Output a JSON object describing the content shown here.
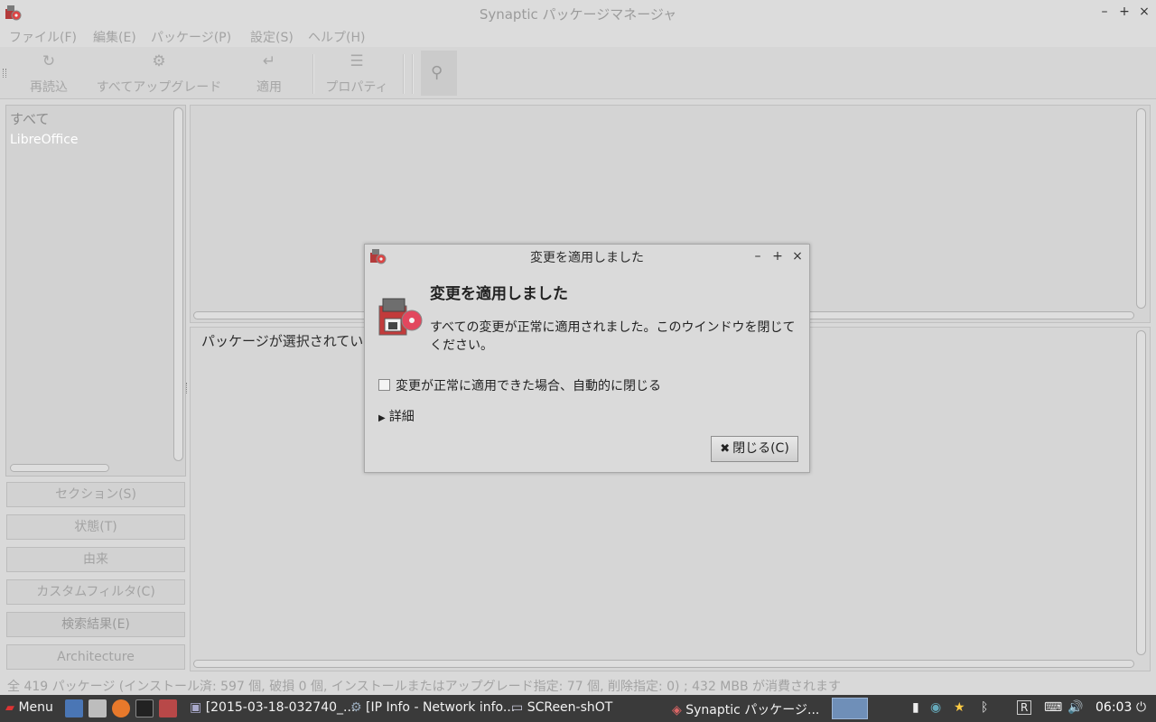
{
  "window": {
    "title": "Synaptic パッケージマネージャ",
    "controls": {
      "minimize": "–",
      "maximize": "+",
      "close": "×"
    }
  },
  "menubar": {
    "items": [
      "ファイル(F)",
      "編集(E)",
      "パッケージ(P)",
      "設定(S)",
      "ヘルプ(H)"
    ]
  },
  "toolbar": {
    "reload": {
      "label": "再読込",
      "icon": "reload-icon",
      "glyph": "↻"
    },
    "upgrade_all": {
      "label": "すべてアップグレード",
      "icon": "gear-icon",
      "glyph": "⚙"
    },
    "apply": {
      "label": "適用",
      "icon": "apply-icon",
      "glyph": "↵"
    },
    "properties": {
      "label": "プロパティ",
      "icon": "properties-icon",
      "glyph": "☰"
    },
    "search": {
      "icon": "search-icon",
      "glyph": "⚲"
    }
  },
  "sidebar": {
    "categories": [
      "すべて",
      "LibreOffice"
    ],
    "filters": [
      "セクション(S)",
      "状態(T)",
      "由来",
      "カスタムフィルタ(C)",
      "検索結果(E)",
      "Architecture"
    ]
  },
  "description": {
    "text": "パッケージが選択されてい"
  },
  "status": {
    "text": "全 419 パッケージ (インストール済: 597 個, 破損 0 個, インストールまたはアップグレード指定: 77 個, 削除指定: 0) ; 432 MBB が消費されます"
  },
  "dialog": {
    "title": "変更を適用しました",
    "heading": "変更を適用しました",
    "message": "すべての変更が正常に適用されました。このウインドウを閉じてください。",
    "auto_close_label": "変更が正常に適用できた場合、自動的に閉じる",
    "auto_close_checked": false,
    "details_label": "詳細",
    "close_button": "閉じる(C)",
    "controls": {
      "minimize": "–",
      "maximize": "+",
      "close": "×"
    }
  },
  "taskbar": {
    "menu_label": "Menu",
    "tasks": [
      "[2015-03-18-032740_...",
      "[IP Info - Network info...",
      "SCReen-shOT",
      "Synaptic パッケージ..."
    ],
    "tray": {
      "r_label": "R"
    },
    "clock": "06:03"
  },
  "colors": {
    "taskbar_bg": "#3a3a3a",
    "window_bg": "#d9d9d9",
    "active_task": "#6f8fb8"
  }
}
